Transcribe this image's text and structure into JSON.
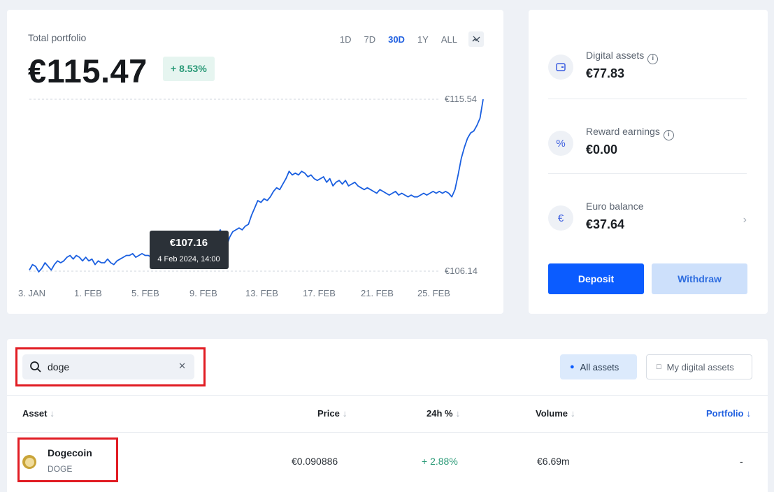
{
  "portfolio": {
    "label": "Total portfolio",
    "value": "€115.47",
    "change": "+ 8.53%",
    "ranges": [
      "1D",
      "7D",
      "30D",
      "1Y",
      "ALL"
    ],
    "active_range": "30D",
    "tooltip": {
      "value": "€107.16",
      "date": "4 Feb 2024, 14:00"
    }
  },
  "chart_data": {
    "type": "line",
    "x_ticks": [
      "3. JAN",
      "1. FEB",
      "5. FEB",
      "9. FEB",
      "13. FEB",
      "17. FEB",
      "21. FEB",
      "25. FEB"
    ],
    "y_ticks": [
      "€115.54",
      "€106.14"
    ],
    "ylim": [
      106.14,
      115.54
    ],
    "grid": "dashed max/min lines",
    "color": "#1a5fe0",
    "values": [
      106.2,
      106.5,
      106.4,
      106.1,
      106.3,
      106.6,
      106.4,
      106.2,
      106.5,
      106.7,
      106.6,
      106.7,
      106.9,
      107.0,
      106.8,
      107.0,
      106.9,
      106.7,
      106.9,
      106.7,
      106.8,
      106.5,
      106.7,
      106.6,
      106.6,
      106.8,
      106.6,
      106.5,
      106.7,
      106.8,
      106.9,
      107.0,
      107.0,
      107.1,
      106.9,
      107.0,
      107.1,
      107.0,
      107.0,
      106.9,
      106.7,
      106.9,
      107.1,
      107.16,
      107.3,
      107.0,
      106.8,
      106.6,
      106.9,
      107.1,
      107.2,
      107.0,
      107.1,
      107.2,
      107.5,
      107.3,
      107.5,
      107.6,
      107.6,
      107.9,
      108.1,
      108.4,
      108.0,
      107.5,
      108.0,
      108.3,
      108.4,
      108.5,
      108.4,
      108.6,
      108.7,
      109.2,
      109.6,
      110.0,
      109.9,
      110.1,
      110.0,
      110.2,
      110.5,
      110.7,
      110.6,
      110.9,
      111.2,
      111.6,
      111.4,
      111.5,
      111.4,
      111.6,
      111.5,
      111.3,
      111.4,
      111.2,
      111.1,
      111.2,
      111.3,
      111.0,
      111.2,
      110.8,
      111.0,
      111.1,
      110.9,
      111.1,
      110.8,
      110.9,
      111.0,
      110.8,
      110.7,
      110.6,
      110.7,
      110.6,
      110.5,
      110.4,
      110.6,
      110.5,
      110.4,
      110.3,
      110.4,
      110.5,
      110.3,
      110.4,
      110.3,
      110.2,
      110.3,
      110.2,
      110.2,
      110.3,
      110.4,
      110.3,
      110.4,
      110.5,
      110.4,
      110.5,
      110.4,
      110.5,
      110.4,
      110.2,
      110.6,
      111.4,
      112.3,
      112.9,
      113.4,
      113.7,
      113.8,
      114.1,
      114.5,
      115.54
    ]
  },
  "balances": {
    "digital_assets": {
      "label": "Digital assets",
      "value": "€77.83"
    },
    "reward_earnings": {
      "label": "Reward earnings",
      "value": "€0.00"
    },
    "euro_balance": {
      "label": "Euro balance",
      "value": "€37.64"
    },
    "deposit_label": "Deposit",
    "withdraw_label": "Withdraw"
  },
  "assets": {
    "search_value": "doge",
    "filters": {
      "all": "All assets",
      "mine": "My digital assets"
    },
    "columns": {
      "asset": "Asset",
      "price": "Price",
      "change": "24h %",
      "volume": "Volume",
      "portfolio": "Portfolio"
    },
    "rows": [
      {
        "name": "Dogecoin",
        "symbol": "DOGE",
        "price": "€0.090886",
        "change": "+ 2.88%",
        "volume": "€6.69m",
        "portfolio": "-"
      }
    ]
  },
  "colors": {
    "accent": "#0b5cff",
    "positive": "#2a9a77",
    "highlight": "#e11c23",
    "line": "#1a5fe0"
  }
}
